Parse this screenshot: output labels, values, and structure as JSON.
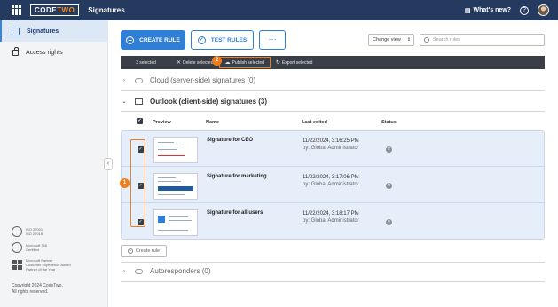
{
  "topbar": {
    "logo_code": "CODE",
    "logo_two": "TWO",
    "app_title": "Signatures",
    "whats_new": "What's new?",
    "help": "?"
  },
  "sidebar": {
    "items": [
      {
        "label": "Signatures",
        "icon": "signature-icon",
        "active": true
      },
      {
        "label": "Access rights",
        "icon": "lock-icon",
        "active": false
      }
    ],
    "certs": [
      {
        "text": "ISO 27001\nISO 27018"
      },
      {
        "text": "Microsoft 365\nCertified"
      },
      {
        "text": "Microsoft Partner\nCustomer Experience Award\nPartner of the Year"
      }
    ],
    "copyright": "Copyright 2024 CodeTwo.\nAll rights reserved."
  },
  "toolbar": {
    "create_rule": "CREATE RULE",
    "test_rules": "TEST RULES",
    "more": "···",
    "view_select": "Change view",
    "search_placeholder": "Search rules"
  },
  "actionbar": {
    "selected": "3 selected",
    "delete": "Delete selected",
    "publish": "Publish selected",
    "export": "Export selected"
  },
  "groups": {
    "cloud": "Cloud (server-side) signatures (0)",
    "outlook": "Outlook (client-side) signatures (3)",
    "autoresponders": "Autoresponders (0)"
  },
  "table": {
    "headers": {
      "preview": "Preview",
      "name": "Name",
      "last_edited": "Last edited",
      "status": "Status"
    },
    "rows": [
      {
        "name": "Signature for CEO",
        "date": "11/22/2024, 3:16:25 PM",
        "by": "by: Global Administrator"
      },
      {
        "name": "Signature for marketing",
        "date": "11/22/2024, 3:17:06 PM",
        "by": "by: Global Administrator"
      },
      {
        "name": "Signature for all users",
        "date": "11/22/2024, 3:18:17 PM",
        "by": "by: Global Administrator"
      }
    ]
  },
  "create_rule_link": "Create rule",
  "annotations": {
    "badge1": "1",
    "badge2": "2"
  },
  "colors": {
    "accent": "#2f7fd6",
    "topbar": "#243a5e",
    "highlight": "#f07d1a"
  }
}
